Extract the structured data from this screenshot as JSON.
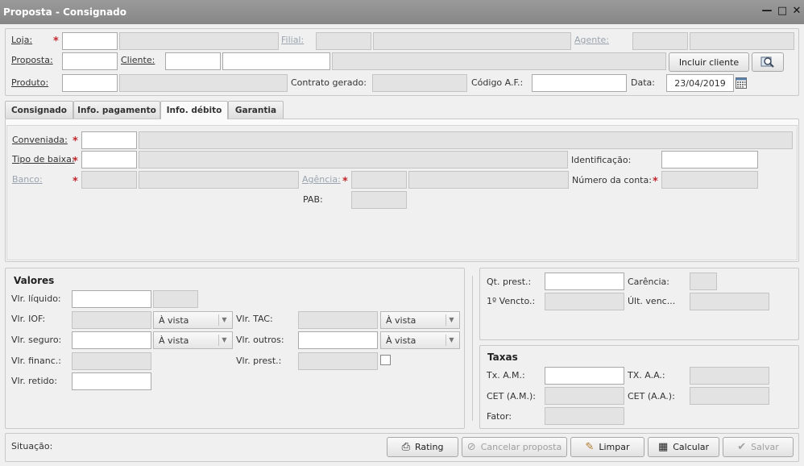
{
  "window": {
    "title": "Proposta - Consignado"
  },
  "header": {
    "loja_label": "Loja:",
    "filial_label": "Filial:",
    "agente_label": "Agente:",
    "proposta_label": "Proposta:",
    "cliente_label": "Cliente:",
    "incluir_cliente_label": "Incluir cliente",
    "produto_label": "Produto:",
    "contrato_label": "Contrato gerado:",
    "codigo_af_label": "Código A.F.:",
    "data_label": "Data:",
    "data_value": "23/04/2019",
    "required_mark": "*"
  },
  "tabs": [
    {
      "label": "Consignado"
    },
    {
      "label": "Info. pagamento"
    },
    {
      "label": "Info. débito"
    },
    {
      "label": "Garantia"
    }
  ],
  "debito": {
    "conveniada_label": "Conveniada:",
    "tipo_baixa_label": "Tipo de baixa:",
    "identificacao_label": "Identificação:",
    "banco_label": "Banco:",
    "agencia_label": "Agência:",
    "numero_conta_label": "Número da conta:",
    "pab_label": "PAB:"
  },
  "valores": {
    "title": "Valores",
    "liquido_label": "Vlr. líquido:",
    "iof_label": "Vlr. IOF:",
    "iof_option": "À vista",
    "tac_label": "Vlr. TAC:",
    "tac_option": "À vista",
    "seguro_label": "Vlr. seguro:",
    "seguro_option": "À vista",
    "outros_label": "Vlr. outros:",
    "outros_option": "À vista",
    "financ_label": "Vlr. financ.:",
    "prest_label": "Vlr. prest.:",
    "retido_label": "Vlr. retido:"
  },
  "prestacoes": {
    "qt_label": "Qt. prest.:",
    "carencia_label": "Carência:",
    "primeiro_label": "1º Vencto.:",
    "ultimo_label": "Últ. venc..."
  },
  "taxas": {
    "title": "Taxas",
    "txam_label": "Tx. A.M.:",
    "txaa_label": "TX. A.A.:",
    "cetam_label": "CET (A.M.):",
    "cetaa_label": "CET (A.A.):",
    "fator_label": "Fator:"
  },
  "footer": {
    "situacao_label": "Situação:",
    "rating_label": "Rating",
    "cancelar_label": "Cancelar proposta",
    "limpar_label": "Limpar",
    "calcular_label": "Calcular",
    "salvar_label": "Salvar"
  }
}
